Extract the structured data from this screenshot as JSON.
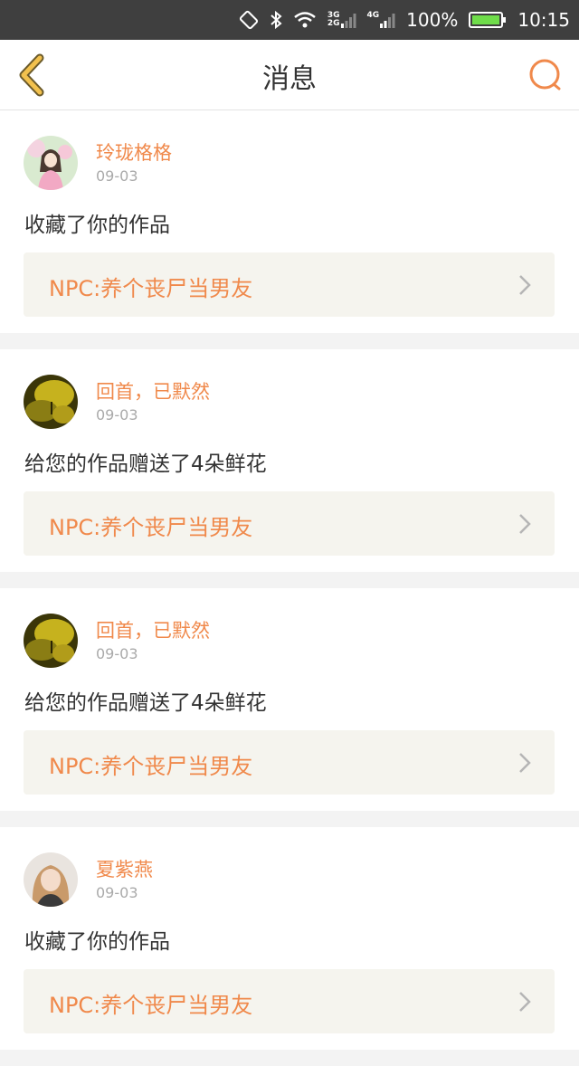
{
  "status_bar": {
    "net1_top": "3G",
    "net1_bottom": "2G",
    "net2": "4G",
    "battery": "100%",
    "time": "10:15"
  },
  "header": {
    "title": "消息",
    "back_icon": "chevron-left-icon",
    "search_icon": "search-icon",
    "accent": "#f0894b"
  },
  "messages": [
    {
      "username": "玲珑格格",
      "date": "09-03",
      "action": "收藏了你的作品",
      "work_title": "NPC:养个丧尸当男友"
    },
    {
      "username": "回首，已默然",
      "date": "09-03",
      "action": "给您的作品赠送了4朵鲜花",
      "work_title": "NPC:养个丧尸当男友"
    },
    {
      "username": "回首，已默然",
      "date": "09-03",
      "action": "给您的作品赠送了4朵鲜花",
      "work_title": "NPC:养个丧尸当男友"
    },
    {
      "username": "夏紫燕",
      "date": "09-03",
      "action": "收藏了你的作品",
      "work_title": "NPC:养个丧尸当男友"
    }
  ]
}
